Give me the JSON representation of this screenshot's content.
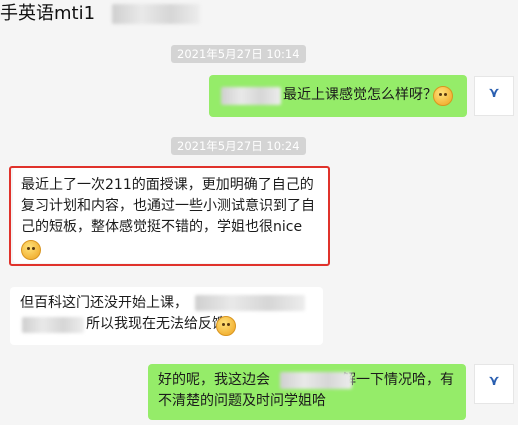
{
  "header": {
    "title": "手英语mti1"
  },
  "messages": [
    {
      "type": "timestamp",
      "text": "2021年5月27日 10:14"
    },
    {
      "type": "outgoing",
      "lines": [
        "最近上课感觉怎么样呀？"
      ],
      "emoji": "smile-emoji",
      "avatar_icon": "company-logo-icon"
    },
    {
      "type": "timestamp",
      "text": "2021年5月27日 10:24"
    },
    {
      "type": "incoming",
      "lines": [
        "最近上了一次211的面授课，更加明确了自己的",
        "复习计划和内容，也通过一些小测试意识到了自",
        "己的短板，整体感觉挺不错的，学姐也很nice"
      ],
      "emoji": "laugh-emoji",
      "highlighted": true
    },
    {
      "type": "incoming",
      "lines": [
        "但百科这门还没开始上课，",
        "所以我现在无法给反馈"
      ],
      "emoji": "cry-laugh-emoji"
    },
    {
      "type": "outgoing",
      "lines": [
        "好的呢，我这边会",
        "解一下情况哈，有",
        "不清楚的问题及时问学姐哈"
      ],
      "avatar_icon": "company-logo-icon"
    }
  ],
  "colors": {
    "outgoing_bubble": "#95ec69",
    "incoming_bubble": "#ffffff",
    "highlight_border": "#e0322b",
    "timestamp_bg": "#d4d4d4"
  }
}
